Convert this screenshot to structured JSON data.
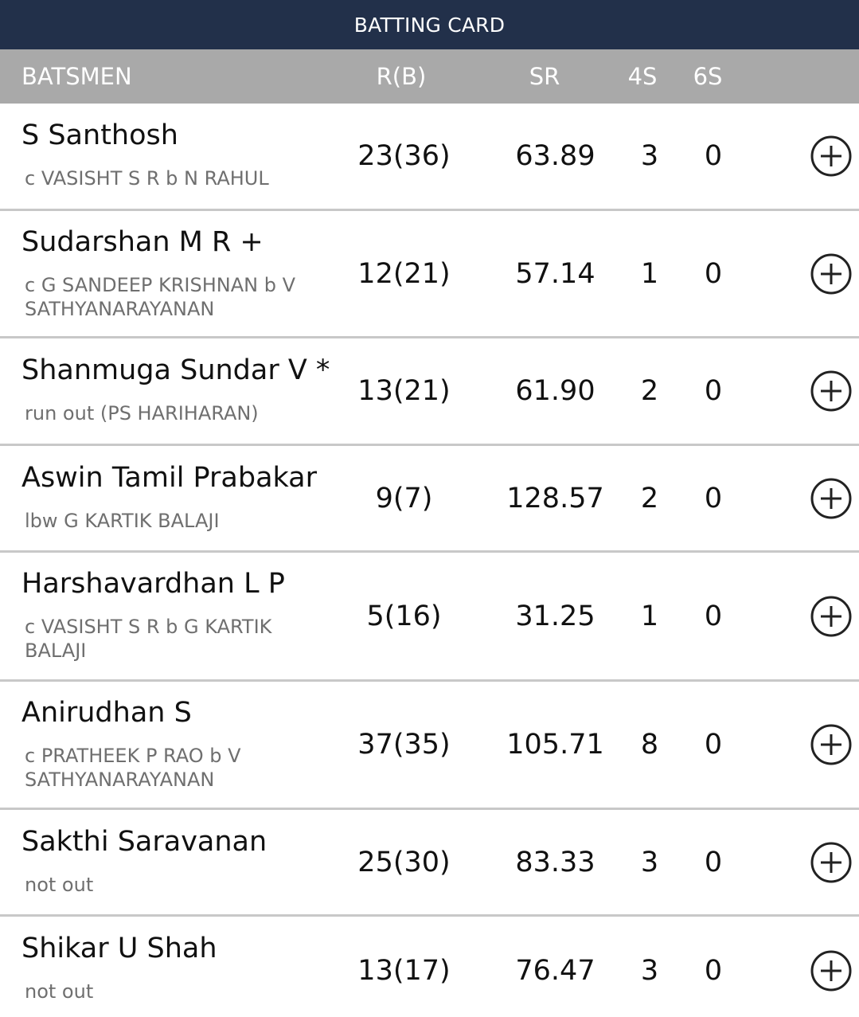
{
  "title": "BATTING CARD",
  "columns": {
    "batsmen": "BATSMEN",
    "runs_balls": "R(B)",
    "strike_rate": "SR",
    "fours": "4S",
    "sixes": "6S"
  },
  "batsmen": [
    {
      "name": "S Santhosh",
      "dismissal": "c VASISHT S R b N RAHUL",
      "rb": "23(36)",
      "sr": "63.89",
      "fours": "3",
      "sixes": "0"
    },
    {
      "name": "Sudarshan M R +",
      "dismissal": "c G SANDEEP KRISHNAN b V SATHYANARAYANAN",
      "rb": "12(21)",
      "sr": "57.14",
      "fours": "1",
      "sixes": "0"
    },
    {
      "name": "Shanmuga Sundar V *",
      "dismissal": "run out (PS HARIHARAN)",
      "rb": "13(21)",
      "sr": "61.90",
      "fours": "2",
      "sixes": "0"
    },
    {
      "name": "Aswin Tamil Prabakar",
      "dismissal": "lbw G KARTIK BALAJI",
      "rb": "9(7)",
      "sr": "128.57",
      "fours": "2",
      "sixes": "0"
    },
    {
      "name": "Harshavardhan L P",
      "dismissal": "c VASISHT S R b G KARTIK BALAJI",
      "rb": "5(16)",
      "sr": "31.25",
      "fours": "1",
      "sixes": "0"
    },
    {
      "name": "Anirudhan S",
      "dismissal": "c PRATHEEK P RAO b V SATHYANARAYANAN",
      "rb": "37(35)",
      "sr": "105.71",
      "fours": "8",
      "sixes": "0"
    },
    {
      "name": "Sakthi Saravanan",
      "dismissal": "not out",
      "rb": "25(30)",
      "sr": "83.33",
      "fours": "3",
      "sixes": "0"
    },
    {
      "name": "Shikar U Shah",
      "dismissal": "not out",
      "rb": "13(17)",
      "sr": "76.47",
      "fours": "3",
      "sixes": "0"
    }
  ],
  "row_icon": "plus-circle-icon",
  "colors": {
    "title_bar": "#22304a",
    "header_bar": "#a9a9a9",
    "divider": "#c8c8c8"
  }
}
